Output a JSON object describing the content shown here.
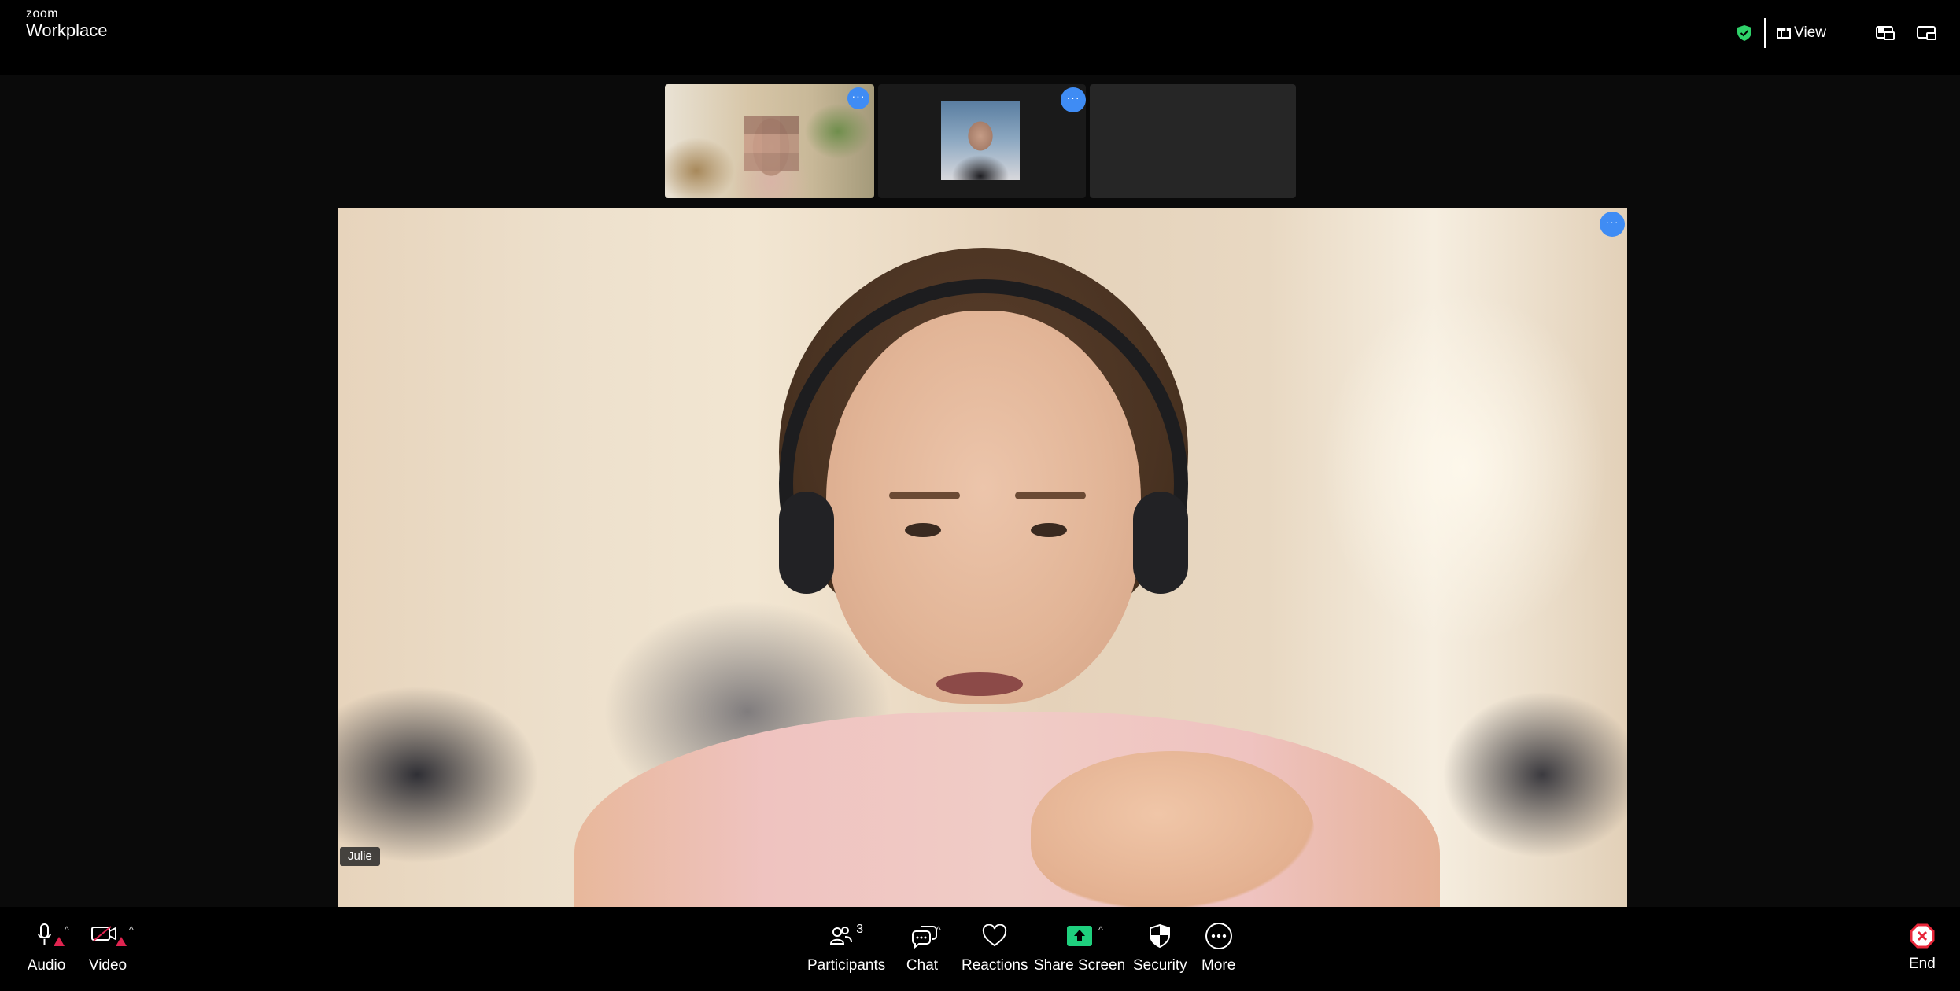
{
  "app": {
    "logo_small": "zoom",
    "logo_big": "Workplace"
  },
  "topbar": {
    "view_label": "View",
    "shield_color": "#2fd26a",
    "icons": [
      "shield-check-icon",
      "view-grid-icon",
      "pip-icon",
      "fullscreen-icon"
    ]
  },
  "main_video": {
    "participant_name": "Julie"
  },
  "toolbar": {
    "audio_label": "Audio",
    "video_label": "Video",
    "participants_label": "Participants",
    "participants_count": "3",
    "chat_label": "Chat",
    "reactions_label": "Reactions",
    "share_label": "Share Screen",
    "security_label": "Security",
    "more_label": "More",
    "end_label": "End",
    "share_color": "#1fd07e",
    "end_color": "#e8273a",
    "alert_color": "#e02450",
    "more_badge_color": "#3f8cf4"
  }
}
